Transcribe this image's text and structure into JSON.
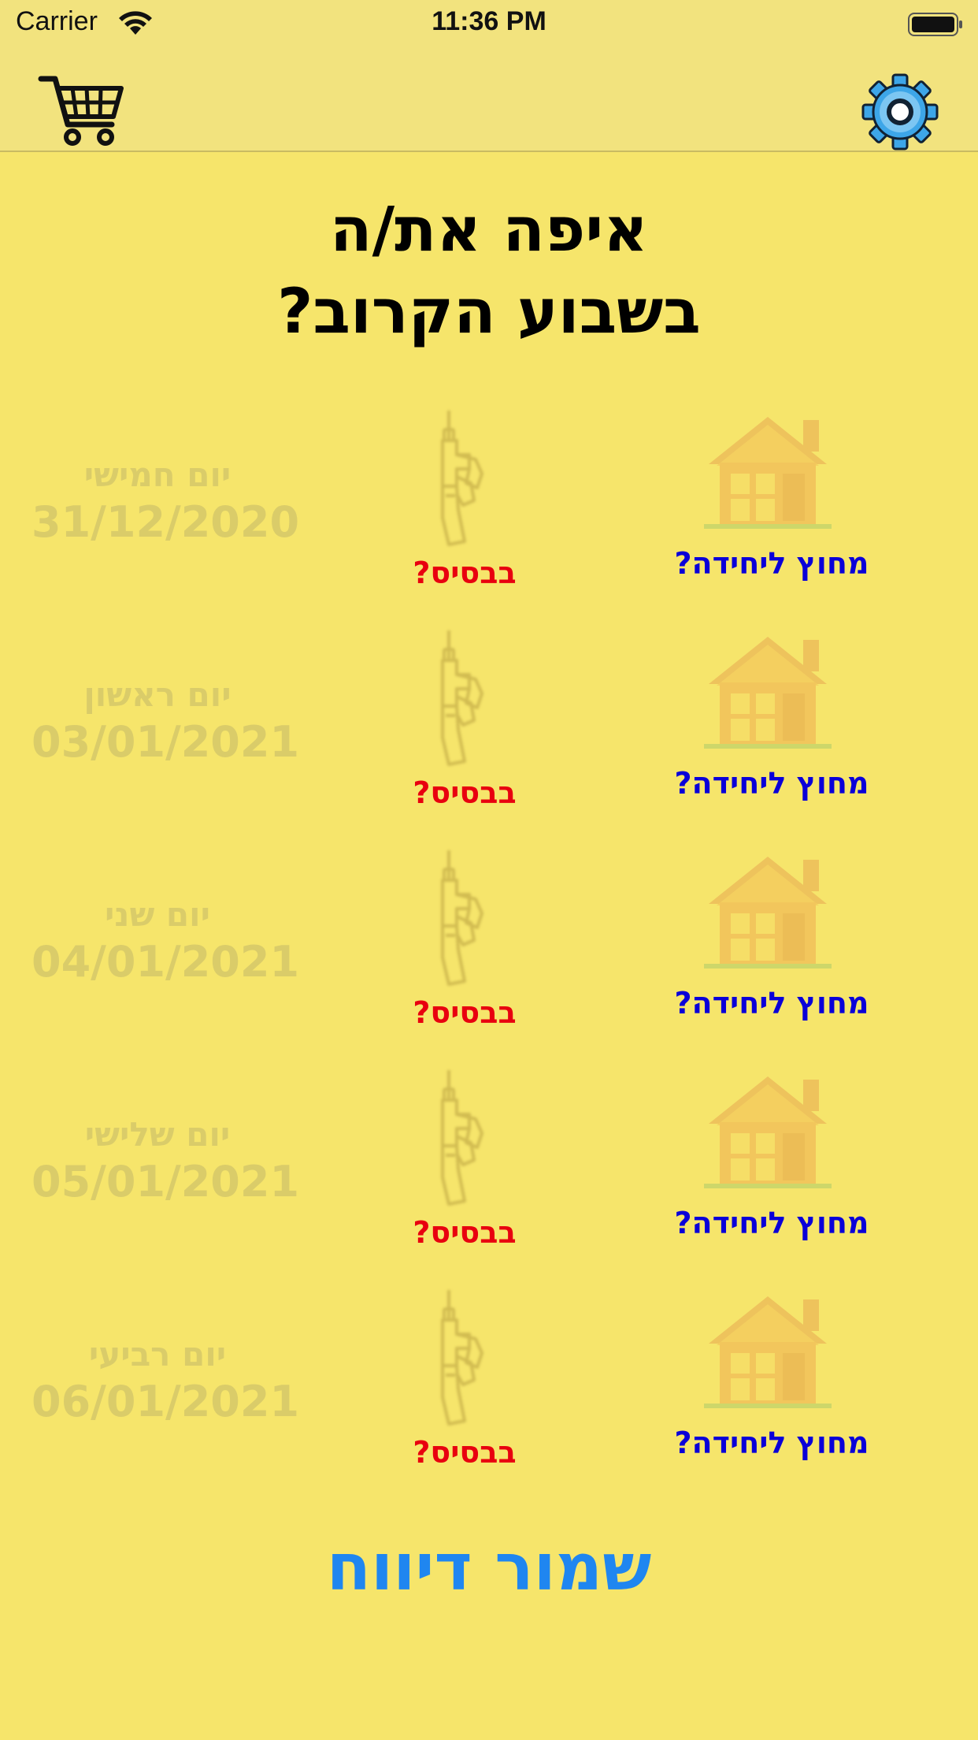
{
  "status_bar": {
    "carrier": "Carrier",
    "time": "11:36 PM"
  },
  "nav": {
    "cart_icon": "shopping-cart-icon",
    "settings_icon": "gear-icon"
  },
  "title": {
    "line1": "איפה את/ה",
    "line2": "בשבוע הקרוב?"
  },
  "days": [
    {
      "day_name": "יום חמישי",
      "date": "31/12/2020",
      "base_label": "בבסיס?",
      "home_label": "מחוץ ליחידה?"
    },
    {
      "day_name": "יום ראשון",
      "date": "03/01/2021",
      "base_label": "בבסיס?",
      "home_label": "מחוץ ליחידה?"
    },
    {
      "day_name": "יום שני",
      "date": "04/01/2021",
      "base_label": "בבסיס?",
      "home_label": "מחוץ ליחידה?"
    },
    {
      "day_name": "יום שלישי",
      "date": "05/01/2021",
      "base_label": "בבסיס?",
      "home_label": "מחוץ ליחידה?"
    },
    {
      "day_name": "יום רביעי",
      "date": "06/01/2021",
      "base_label": "בבסיס?",
      "home_label": "מחוץ ליחידה?"
    }
  ],
  "save_button": "שמור דיווח",
  "colors": {
    "background": "#f6e56b",
    "nav_background": "#f2e37e",
    "base_label": "#e8000f",
    "home_label": "#0a00d8",
    "save_button": "#1f86f0",
    "settings_icon": "#3da6e8"
  }
}
